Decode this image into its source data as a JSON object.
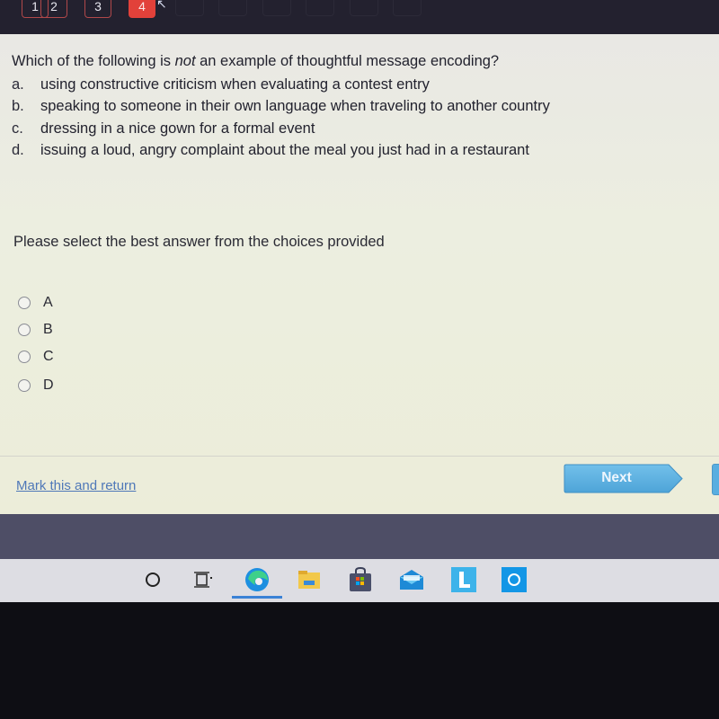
{
  "top_nav": {
    "question_numbers": [
      "1",
      "2",
      "3",
      "4"
    ],
    "active_question": "4"
  },
  "question": {
    "prefix": "Which of the following is ",
    "emphasis": "not",
    "suffix": " an example of thoughtful message encoding?",
    "options": [
      {
        "letter": "a.",
        "text": "using constructive criticism when evaluating a contest entry"
      },
      {
        "letter": "b.",
        "text": "speaking to someone in their own language when traveling to another country"
      },
      {
        "letter": "c.",
        "text": "dressing in a nice gown for a formal event"
      },
      {
        "letter": "d.",
        "text": "issuing a loud, angry complaint about the meal you just had in a restaurant"
      }
    ]
  },
  "instruction": "Please select the best answer from the choices provided",
  "answers": [
    {
      "label": "A",
      "selected": false
    },
    {
      "label": "B",
      "selected": false
    },
    {
      "label": "C",
      "selected": false
    },
    {
      "label": "D",
      "selected": false
    }
  ],
  "footer": {
    "mark_link": "Mark this and return",
    "next_button": "Next"
  },
  "taskbar": {
    "icons": [
      "search-icon",
      "task-view-icon",
      "edge-icon",
      "file-explorer-icon",
      "store-icon",
      "mail-icon",
      "l-app-icon",
      "cortana-icon"
    ],
    "active": "edge-icon"
  },
  "colors": {
    "active_tab": "#e2413a",
    "next_button": "#5fb2e2",
    "link": "#4f78b8"
  }
}
